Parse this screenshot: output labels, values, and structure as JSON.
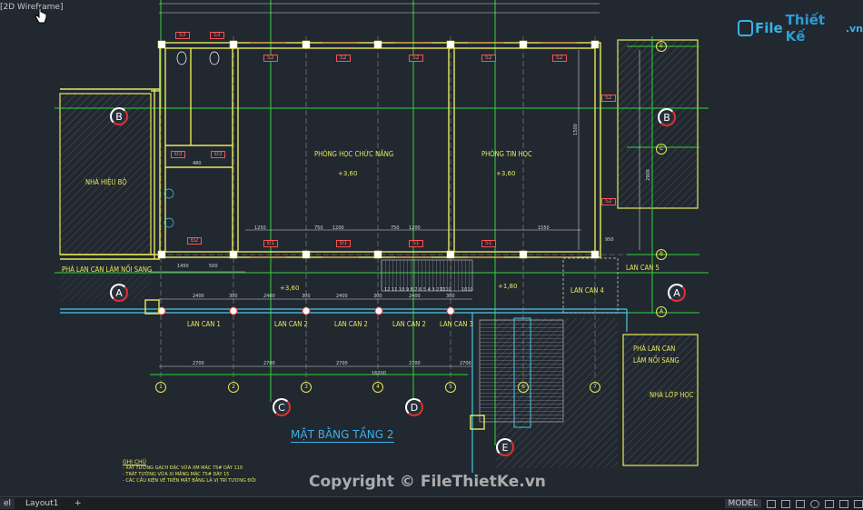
{
  "viewport": {
    "label": "[2D Wireframe]"
  },
  "logo": {
    "main": "File",
    "brand": "Thiết Kế",
    "suffix": ".vn"
  },
  "watermark": "Copyright © FileThietKe.vn",
  "drawing": {
    "title": "MẶT BẰNG TẦNG 2",
    "rooms": {
      "functional_room": "PHÒNG HỌC CHỨC NĂNG",
      "it_room": "PHÒNG TIN HỌC",
      "principal_building": "NHÀ HIỆU BỘ",
      "classroom_building": "NHÀ LỚP HỌC"
    },
    "elevations": {
      "room1": "+3,60",
      "room2": "+3,60",
      "corridor": "+3,60",
      "landing": "+1,80"
    },
    "annotations": {
      "demolish_left": "PHÁ LAN CAN LÀM NỐI SANG",
      "demolish_right_1": "PHÁ LAN CAN",
      "demolish_right_2": "LÀM NỐI SANG",
      "railing1": "LAN CAN 1",
      "railing2a": "LAN CAN 2",
      "railing2b": "LAN CAN 2",
      "railing2c": "LAN CAN 2",
      "railing3": "LAN CAN 3",
      "railing4": "LAN CAN 4",
      "railing5": "LAN CAN 5"
    },
    "grid_letters": {
      "A": "A",
      "B": "B",
      "C": "C",
      "D": "D",
      "E": "E"
    },
    "grid_numbers": [
      "1",
      "2",
      "3",
      "4",
      "5",
      "6",
      "7"
    ],
    "tags": {
      "S1": "S1",
      "S2": "S2",
      "S3": "S3",
      "D1": "Đ1",
      "D2": "Đ2",
      "D3": "Đ3"
    },
    "dimensions": {
      "bay": "2700",
      "sub1": "2400",
      "sub2": "300",
      "total": "16200",
      "d1450": "1450",
      "d500": "500",
      "d480": "480",
      "d1250": "1250",
      "d1550": "1550",
      "d750": "750",
      "d1200": "1200",
      "d2900": "2900",
      "d1500": "1500",
      "d950": "950",
      "d1310": "1310",
      "d1010": "1010",
      "stairs": "12 11 10 9 8 7 6 5 4 3 2 1"
    },
    "notes": {
      "heading": "GHI CHÚ",
      "lines": [
        "- XÂY TƯỜNG GẠCH ĐẶC VỮA XM MÁC 75# DÀY 110",
        "- TRÁT TƯỜNG VỮA XI MĂNG MÁC 75# DÀY 15",
        "- CÁC CẤU KIỆN VẼ TRÊN MẶT BẰNG LÀ VỊ TRÍ TƯƠNG ĐỐI"
      ]
    }
  },
  "statusbar": {
    "tabs": [
      "el",
      "Layout1",
      "+"
    ],
    "model_button": "MODEL"
  }
}
